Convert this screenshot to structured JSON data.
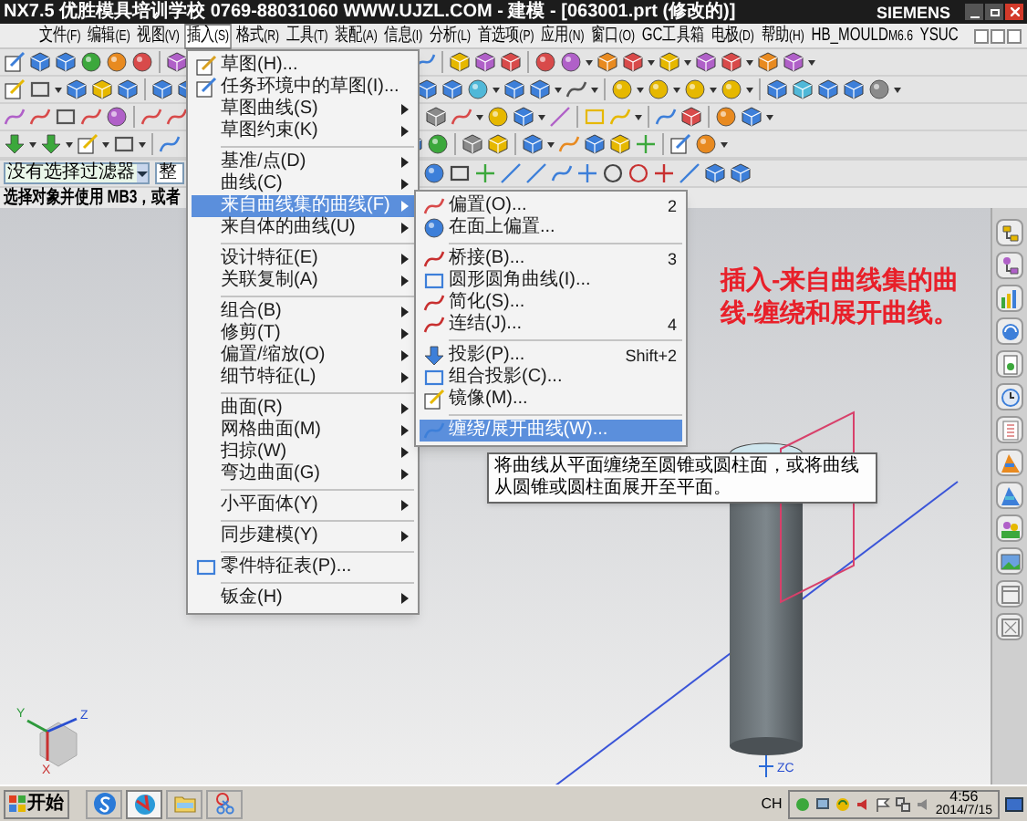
{
  "window": {
    "title": "NX7.5 优胜模具培训学校 0769-88031060 WWW.UJZL.COM - 建模 - [063001.prt (修改的)]",
    "brand": "SIEMENS"
  },
  "menu_bar": [
    {
      "label": "文件",
      "accel": "(F)",
      "selected": false
    },
    {
      "label": "编辑",
      "accel": "(E)",
      "selected": false
    },
    {
      "label": "视图",
      "accel": "(V)",
      "selected": false
    },
    {
      "label": "插入",
      "accel": "(S)",
      "selected": true
    },
    {
      "label": "格式",
      "accel": "(R)",
      "selected": false
    },
    {
      "label": "工具",
      "accel": "(T)",
      "selected": false
    },
    {
      "label": "装配",
      "accel": "(A)",
      "selected": false
    },
    {
      "label": "信息",
      "accel": "(I)",
      "selected": false
    },
    {
      "label": "分析",
      "accel": "(L)",
      "selected": false
    },
    {
      "label": "首选项",
      "accel": "(P)",
      "selected": false
    },
    {
      "label": "应用",
      "accel": "(N)",
      "selected": false
    },
    {
      "label": "窗口",
      "accel": "(O)",
      "selected": false
    },
    {
      "label": "GC工具箱",
      "selected": false
    },
    {
      "label": "电极",
      "accel": "(D)",
      "selected": false
    },
    {
      "label": "帮助",
      "accel": "(H)",
      "selected": false
    },
    {
      "label": "HB_MOULD",
      "accel": "M6.6",
      "selected": false
    },
    {
      "label": "YSUC",
      "selected": false
    }
  ],
  "selection_bar": {
    "filter": "没有选择过滤器",
    "scope": "整"
  },
  "prompt": "选择对象并使用 MB3，或者",
  "insert_menu": [
    {
      "kind": "command",
      "label": "草图(H)...",
      "selected": false
    },
    {
      "kind": "command",
      "label": "任务环境中的草图(I)...",
      "selected": false
    },
    {
      "kind": "submenu",
      "label": "草图曲线(S)",
      "selected": false
    },
    {
      "kind": "submenu",
      "label": "草图约束(K)",
      "selected": false
    },
    {
      "kind": "separator"
    },
    {
      "kind": "submenu",
      "label": "基准/点(D)",
      "selected": false
    },
    {
      "kind": "submenu",
      "label": "曲线(C)",
      "selected": false
    },
    {
      "kind": "submenu",
      "label": "来自曲线集的曲线(F)",
      "selected": true
    },
    {
      "kind": "submenu",
      "label": "来自体的曲线(U)",
      "selected": false
    },
    {
      "kind": "separator"
    },
    {
      "kind": "submenu",
      "label": "设计特征(E)",
      "selected": false
    },
    {
      "kind": "submenu",
      "label": "关联复制(A)",
      "selected": false
    },
    {
      "kind": "separator"
    },
    {
      "kind": "submenu",
      "label": "组合(B)",
      "selected": false
    },
    {
      "kind": "submenu",
      "label": "修剪(T)",
      "selected": false
    },
    {
      "kind": "submenu",
      "label": "偏置/缩放(O)",
      "selected": false
    },
    {
      "kind": "submenu",
      "label": "细节特征(L)",
      "selected": false
    },
    {
      "kind": "separator"
    },
    {
      "kind": "submenu",
      "label": "曲面(R)",
      "selected": false
    },
    {
      "kind": "submenu",
      "label": "网格曲面(M)",
      "selected": false
    },
    {
      "kind": "submenu",
      "label": "扫掠(W)",
      "selected": false
    },
    {
      "kind": "submenu",
      "label": "弯边曲面(G)",
      "selected": false
    },
    {
      "kind": "separator"
    },
    {
      "kind": "submenu",
      "label": "小平面体(Y)",
      "selected": false
    },
    {
      "kind": "separator"
    },
    {
      "kind": "submenu",
      "label": "同步建模(Y)",
      "selected": false
    },
    {
      "kind": "separator"
    },
    {
      "kind": "command",
      "label": "零件特征表(P)...",
      "selected": false
    },
    {
      "kind": "separator"
    },
    {
      "kind": "submenu",
      "label": "钣金(H)",
      "selected": false
    }
  ],
  "curve_submenu": [
    {
      "kind": "command",
      "label": "偏置(O)...",
      "shortcut": "2",
      "selected": false
    },
    {
      "kind": "command",
      "label": "在面上偏置...",
      "selected": false
    },
    {
      "kind": "separator"
    },
    {
      "kind": "command",
      "label": "桥接(B)...",
      "shortcut": "3",
      "selected": false
    },
    {
      "kind": "command",
      "label": "圆形圆角曲线(I)...",
      "selected": false
    },
    {
      "kind": "command",
      "label": "简化(S)...",
      "selected": false
    },
    {
      "kind": "command",
      "label": "连结(J)...",
      "shortcut": "4",
      "selected": false
    },
    {
      "kind": "separator"
    },
    {
      "kind": "command",
      "label": "投影(P)...",
      "shortcut": "Shift+2",
      "selected": false
    },
    {
      "kind": "command",
      "label": "组合投影(C)...",
      "selected": false
    },
    {
      "kind": "command",
      "label": "镜像(M)...",
      "selected": false
    },
    {
      "kind": "separator"
    },
    {
      "kind": "command",
      "label": "缠绕/展开曲线(W)...",
      "selected": true
    }
  ],
  "tooltip": "将曲线从平面缠绕至圆锥或圆柱面，或将曲线从圆锥或圆柱面展开至平面。",
  "annotation": "插入-来自曲线集的曲线-缠绕和展开曲线。",
  "viewport": {
    "wcs_label": "ZC",
    "triad": {
      "x": "X",
      "y": "Y",
      "z": "Z"
    }
  },
  "taskbar": {
    "start": "开始",
    "apps": [
      {
        "kind": "s-logo",
        "selected": false
      },
      {
        "kind": "globe",
        "selected": true
      },
      {
        "kind": "folder",
        "selected": false
      },
      {
        "kind": "scissors",
        "selected": false
      }
    ],
    "language": "CH",
    "time": "4:56",
    "date": "2014/7/15"
  }
}
